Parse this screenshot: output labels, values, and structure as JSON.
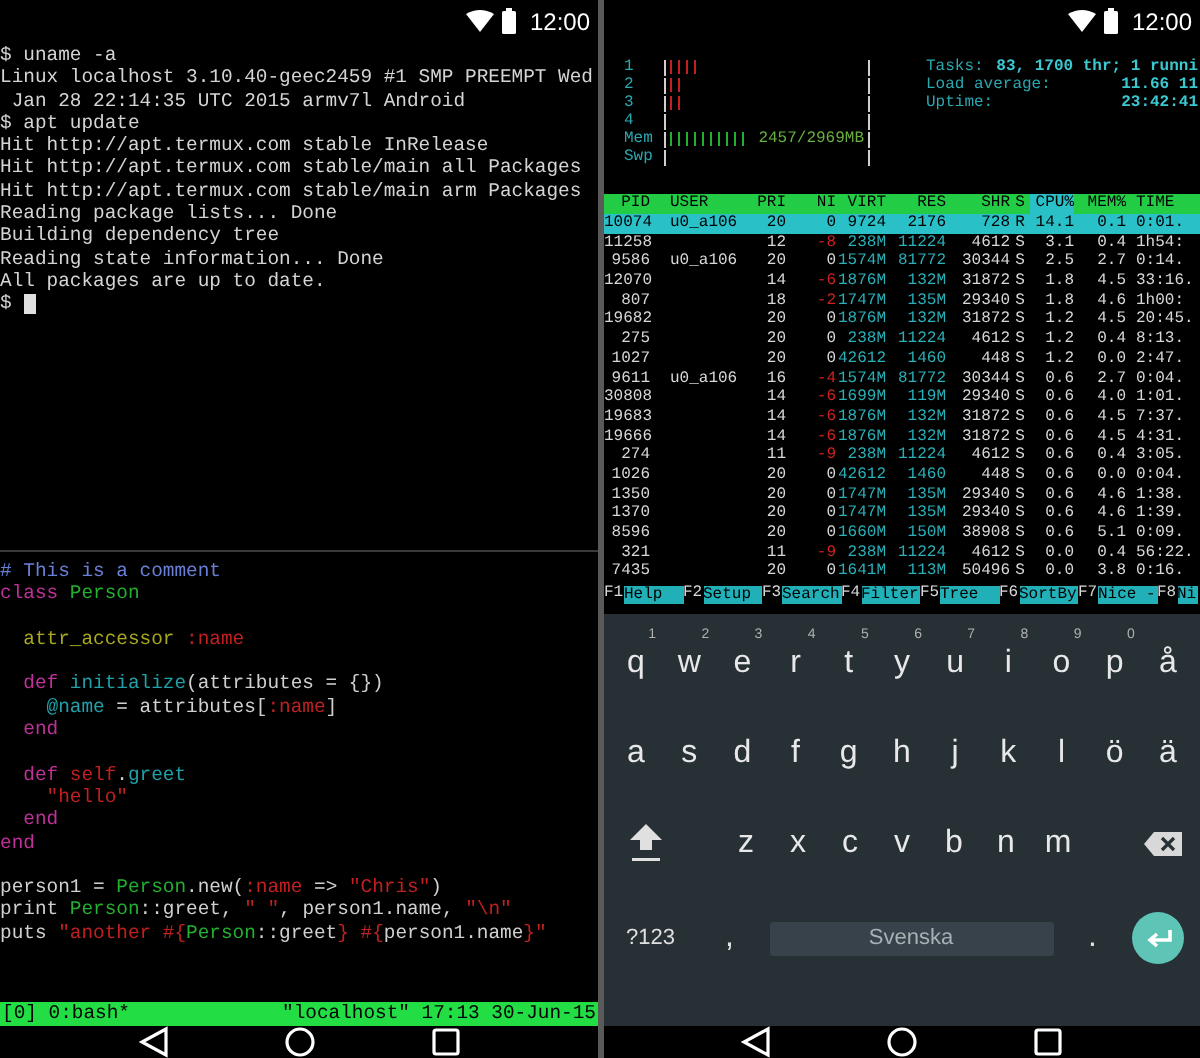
{
  "left_phone": {
    "status_bar": {
      "time": "12:00"
    },
    "terminal": {
      "lines": [
        "$ uname -a",
        "Linux localhost 3.10.40-geec2459 #1 SMP PREEMPT Wed",
        " Jan 28 22:14:35 UTC 2015 armv7l Android",
        "$ apt update",
        "Hit http://apt.termux.com stable InRelease",
        "Hit http://apt.termux.com stable/main all Packages",
        "Hit http://apt.termux.com stable/main arm Packages",
        "Reading package lists... Done",
        "Building dependency tree",
        "Reading state information... Done",
        "All packages are up to date.",
        "$"
      ]
    },
    "editor": {
      "lines": [
        {
          "kind": "code",
          "segments": [
            {
              "text": "# This is a comment",
              "color": "#6a80d8"
            }
          ]
        },
        {
          "kind": "code",
          "segments": [
            {
              "text": "class",
              "color": "#c0309a"
            },
            {
              "text": " Person",
              "color": "#22b030"
            }
          ]
        },
        {
          "kind": "blank"
        },
        {
          "kind": "code",
          "segments": [
            {
              "text": "  attr_accessor",
              "color": "#a8a820"
            },
            {
              "text": " :name",
              "color": "#c02020"
            }
          ]
        },
        {
          "kind": "blank"
        },
        {
          "kind": "code",
          "segments": [
            {
              "text": "  def",
              "color": "#c0309a"
            },
            {
              "text": " initialize",
              "color": "#20a0a8"
            },
            {
              "text": "(attributes = {})",
              "color": "#d0d0d0"
            }
          ]
        },
        {
          "kind": "code",
          "segments": [
            {
              "text": "    @name",
              "color": "#20a0a8"
            },
            {
              "text": " = attributes[",
              "color": "#d0d0d0"
            },
            {
              "text": ":name",
              "color": "#c02020"
            },
            {
              "text": "]",
              "color": "#d0d0d0"
            }
          ]
        },
        {
          "kind": "code",
          "segments": [
            {
              "text": "  end",
              "color": "#c0309a"
            }
          ]
        },
        {
          "kind": "blank"
        },
        {
          "kind": "code",
          "segments": [
            {
              "text": "  def",
              "color": "#c0309a"
            },
            {
              "text": " self",
              "color": "#c02020"
            },
            {
              "text": ".",
              "color": "#d0d0d0"
            },
            {
              "text": "greet",
              "color": "#20a0a8"
            }
          ]
        },
        {
          "kind": "code",
          "segments": [
            {
              "text": "    \"hello\"",
              "color": "#c02020"
            }
          ]
        },
        {
          "kind": "code",
          "segments": [
            {
              "text": "  end",
              "color": "#c0309a"
            }
          ]
        },
        {
          "kind": "code",
          "segments": [
            {
              "text": "end",
              "color": "#c0309a"
            }
          ]
        },
        {
          "kind": "blank"
        },
        {
          "kind": "code",
          "segments": [
            {
              "text": "person1 = ",
              "color": "#d0d0d0"
            },
            {
              "text": "Person",
              "color": "#22b030"
            },
            {
              "text": ".new(",
              "color": "#d0d0d0"
            },
            {
              "text": ":name",
              "color": "#c02020"
            },
            {
              "text": " => ",
              "color": "#d0d0d0"
            },
            {
              "text": "\"Chris\"",
              "color": "#c02020"
            },
            {
              "text": ")",
              "color": "#d0d0d0"
            }
          ]
        },
        {
          "kind": "code",
          "segments": [
            {
              "text": "print ",
              "color": "#d0d0d0"
            },
            {
              "text": "Person",
              "color": "#22b030"
            },
            {
              "text": "::greet, ",
              "color": "#d0d0d0"
            },
            {
              "text": "\" \"",
              "color": "#c02020"
            },
            {
              "text": ", person1.name, ",
              "color": "#d0d0d0"
            },
            {
              "text": "\"\\n\"",
              "color": "#c02020"
            }
          ]
        },
        {
          "kind": "code",
          "segments": [
            {
              "text": "puts ",
              "color": "#d0d0d0"
            },
            {
              "text": "\"another #{",
              "color": "#c02020"
            },
            {
              "text": "Person",
              "color": "#22b030"
            },
            {
              "text": "::greet",
              "color": "#d0d0d0"
            },
            {
              "text": "} #{",
              "color": "#c02020"
            },
            {
              "text": "person1.name",
              "color": "#d0d0d0"
            },
            {
              "text": "}\"",
              "color": "#c02020"
            }
          ]
        }
      ]
    },
    "tmux_status": {
      "window": "[0] 0:bash*",
      "info": "\"localhost\" 17:13 30-Jun-15"
    }
  },
  "right_phone": {
    "status_bar": {
      "time": "12:00"
    },
    "htop": {
      "meters": [
        {
          "label": "1",
          "kind": "cpu",
          "level": 0.14
        },
        {
          "label": "2",
          "kind": "cpu",
          "level": 0.07
        },
        {
          "label": "3",
          "kind": "cpu",
          "level": 0.07
        },
        {
          "label": "4",
          "kind": "cpu",
          "level": 0
        },
        {
          "label": "Mem",
          "kind": "memory",
          "level": 0.38,
          "reading": "2457/2969MB"
        },
        {
          "label": "Swp",
          "kind": "swap",
          "level": 0
        }
      ],
      "summary": [
        {
          "label": "Tasks:",
          "value": "83, 1700 thr; 1 runni"
        },
        {
          "label": "Load average:",
          "value": "11.66 11"
        },
        {
          "label": "Uptime:",
          "value": "23:42:41"
        }
      ],
      "columns": [
        {
          "label": "PID",
          "selected": false
        },
        {
          "label": "USER",
          "selected": false
        },
        {
          "label": "PRI",
          "selected": false
        },
        {
          "label": "NI",
          "selected": false
        },
        {
          "label": "VIRT",
          "selected": false
        },
        {
          "label": "RES",
          "selected": false
        },
        {
          "label": "SHR",
          "selected": false
        },
        {
          "label": "S",
          "selected": false
        },
        {
          "label": "CPU%",
          "selected": true
        },
        {
          "label": "MEM%",
          "selected": false
        },
        {
          "label": "TIME",
          "selected": false
        }
      ],
      "rows": [
        {
          "selected": true,
          "ni_negative": false,
          "cells": [
            "10074",
            "u0_a106",
            "20",
            "0",
            "9724",
            "2176",
            "728",
            "R",
            "14.1",
            "0.1",
            "0:01."
          ]
        },
        {
          "selected": false,
          "ni_negative": true,
          "cells": [
            "11258",
            "",
            "12",
            "-8",
            "238M",
            "11224",
            "4612",
            "S",
            "3.1",
            "0.4",
            "1h54:"
          ]
        },
        {
          "selected": false,
          "ni_negative": false,
          "cells": [
            "9586",
            "u0_a106",
            "20",
            "0",
            "1574M",
            "81772",
            "30344",
            "S",
            "2.5",
            "2.7",
            "0:14."
          ]
        },
        {
          "selected": false,
          "ni_negative": true,
          "cells": [
            "12070",
            "",
            "14",
            "-6",
            "1876M",
            "132M",
            "31872",
            "S",
            "1.8",
            "4.5",
            "33:16."
          ]
        },
        {
          "selected": false,
          "ni_negative": true,
          "cells": [
            "807",
            "",
            "18",
            "-2",
            "1747M",
            "135M",
            "29340",
            "S",
            "1.8",
            "4.6",
            "1h00:"
          ]
        },
        {
          "selected": false,
          "ni_negative": false,
          "cells": [
            "19682",
            "",
            "20",
            "0",
            "1876M",
            "132M",
            "31872",
            "S",
            "1.2",
            "4.5",
            "20:45."
          ]
        },
        {
          "selected": false,
          "ni_negative": false,
          "cells": [
            "275",
            "",
            "20",
            "0",
            "238M",
            "11224",
            "4612",
            "S",
            "1.2",
            "0.4",
            "8:13."
          ]
        },
        {
          "selected": false,
          "ni_negative": false,
          "cells": [
            "1027",
            "",
            "20",
            "0",
            "42612",
            "1460",
            "448",
            "S",
            "1.2",
            "0.0",
            "2:47."
          ]
        },
        {
          "selected": false,
          "ni_negative": true,
          "cells": [
            "9611",
            "u0_a106",
            "16",
            "-4",
            "1574M",
            "81772",
            "30344",
            "S",
            "0.6",
            "2.7",
            "0:04."
          ]
        },
        {
          "selected": false,
          "ni_negative": true,
          "cells": [
            "30808",
            "",
            "14",
            "-6",
            "1699M",
            "119M",
            "29340",
            "S",
            "0.6",
            "4.0",
            "1:01."
          ]
        },
        {
          "selected": false,
          "ni_negative": true,
          "cells": [
            "19683",
            "",
            "14",
            "-6",
            "1876M",
            "132M",
            "31872",
            "S",
            "0.6",
            "4.5",
            "7:37."
          ]
        },
        {
          "selected": false,
          "ni_negative": true,
          "cells": [
            "19666",
            "",
            "14",
            "-6",
            "1876M",
            "132M",
            "31872",
            "S",
            "0.6",
            "4.5",
            "4:31."
          ]
        },
        {
          "selected": false,
          "ni_negative": true,
          "cells": [
            "274",
            "",
            "11",
            "-9",
            "238M",
            "11224",
            "4612",
            "S",
            "0.6",
            "0.4",
            "3:05."
          ]
        },
        {
          "selected": false,
          "ni_negative": false,
          "cells": [
            "1026",
            "",
            "20",
            "0",
            "42612",
            "1460",
            "448",
            "S",
            "0.6",
            "0.0",
            "0:04."
          ]
        },
        {
          "selected": false,
          "ni_negative": false,
          "cells": [
            "1350",
            "",
            "20",
            "0",
            "1747M",
            "135M",
            "29340",
            "S",
            "0.6",
            "4.6",
            "1:38."
          ]
        },
        {
          "selected": false,
          "ni_negative": false,
          "cells": [
            "1370",
            "",
            "20",
            "0",
            "1747M",
            "135M",
            "29340",
            "S",
            "0.6",
            "4.6",
            "1:39."
          ]
        },
        {
          "selected": false,
          "ni_negative": false,
          "cells": [
            "8596",
            "",
            "20",
            "0",
            "1660M",
            "150M",
            "38908",
            "S",
            "0.6",
            "5.1",
            "0:09."
          ]
        },
        {
          "selected": false,
          "ni_negative": true,
          "cells": [
            "321",
            "",
            "11",
            "-9",
            "238M",
            "11224",
            "4612",
            "S",
            "0.0",
            "0.4",
            "56:22."
          ]
        },
        {
          "selected": false,
          "ni_negative": false,
          "cells": [
            "7435",
            "",
            "20",
            "0",
            "1641M",
            "113M",
            "50496",
            "S",
            "0.0",
            "3.8",
            "0:16."
          ]
        }
      ],
      "function_keys": [
        {
          "key": "F1",
          "label": "Help"
        },
        {
          "key": "F2",
          "label": "Setup"
        },
        {
          "key": "F3",
          "label": "Search"
        },
        {
          "key": "F4",
          "label": "Filter"
        },
        {
          "key": "F5",
          "label": "Tree"
        },
        {
          "key": "F6",
          "label": "SortBy"
        },
        {
          "key": "F7",
          "label": "Nice -"
        },
        {
          "key": "F8",
          "label": "Ni"
        }
      ]
    },
    "keyboard": {
      "rows": [
        {
          "keys": [
            {
              "kind": "letter",
              "label": "q",
              "hint": "1"
            },
            {
              "kind": "letter",
              "label": "w",
              "hint": "2"
            },
            {
              "kind": "letter",
              "label": "e",
              "hint": "3"
            },
            {
              "kind": "letter",
              "label": "r",
              "hint": "4"
            },
            {
              "kind": "letter",
              "label": "t",
              "hint": "5"
            },
            {
              "kind": "letter",
              "label": "y",
              "hint": "6"
            },
            {
              "kind": "letter",
              "label": "u",
              "hint": "7"
            },
            {
              "kind": "letter",
              "label": "i",
              "hint": "8"
            },
            {
              "kind": "letter",
              "label": "o",
              "hint": "9"
            },
            {
              "kind": "letter",
              "label": "p",
              "hint": "0"
            },
            {
              "kind": "letter",
              "label": "å"
            }
          ]
        },
        {
          "keys": [
            {
              "kind": "letter",
              "label": "a"
            },
            {
              "kind": "letter",
              "label": "s"
            },
            {
              "kind": "letter",
              "label": "d"
            },
            {
              "kind": "letter",
              "label": "f"
            },
            {
              "kind": "letter",
              "label": "g"
            },
            {
              "kind": "letter",
              "label": "h"
            },
            {
              "kind": "letter",
              "label": "j"
            },
            {
              "kind": "letter",
              "label": "k"
            },
            {
              "kind": "letter",
              "label": "l"
            },
            {
              "kind": "letter",
              "label": "ö"
            },
            {
              "kind": "letter",
              "label": "ä"
            }
          ]
        },
        {
          "keys": [
            {
              "kind": "shift"
            },
            {
              "kind": "letter",
              "label": "z"
            },
            {
              "kind": "letter",
              "label": "x"
            },
            {
              "kind": "letter",
              "label": "c"
            },
            {
              "kind": "letter",
              "label": "v"
            },
            {
              "kind": "letter",
              "label": "b"
            },
            {
              "kind": "letter",
              "label": "n"
            },
            {
              "kind": "letter",
              "label": "m"
            },
            {
              "kind": "backspace"
            }
          ]
        },
        {
          "keys": [
            {
              "kind": "symbols",
              "label": "?123"
            },
            {
              "kind": "punct",
              "label": ","
            },
            {
              "kind": "space",
              "label": "Svenska"
            },
            {
              "kind": "punct",
              "label": "."
            },
            {
              "kind": "enter"
            }
          ]
        }
      ]
    }
  }
}
